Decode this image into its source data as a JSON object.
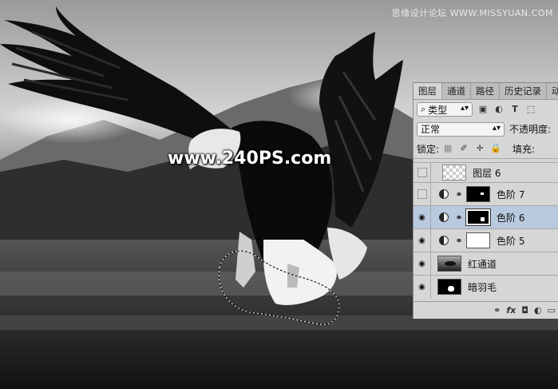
{
  "watermark_top": "思缘设计论坛 WWW.MISSYUAN.COM",
  "watermark_center": "www.240PS.com",
  "panel": {
    "tabs": [
      "图层",
      "通道",
      "路径",
      "历史记录",
      "动"
    ],
    "filter_label": "类型",
    "blend_mode": "正常",
    "opacity_label": "不透明度:",
    "lock_label": "锁定:",
    "fill_label": "填充:",
    "layers": [
      {
        "name": "图层 6",
        "visible": false,
        "type": "pixel"
      },
      {
        "name": "色阶 7",
        "visible": false,
        "type": "adjustment"
      },
      {
        "name": "色阶 6",
        "visible": true,
        "type": "adjustment",
        "selected": true
      },
      {
        "name": "色阶 5",
        "visible": true,
        "type": "adjustment"
      },
      {
        "name": "红通道",
        "visible": true,
        "type": "pixel"
      },
      {
        "name": "暗羽毛",
        "visible": true,
        "type": "pixel"
      }
    ],
    "footer_icons": [
      "link-icon",
      "fx-icon",
      "mask-icon",
      "adjustment-icon",
      "folder-icon"
    ],
    "footer_fx": "fx"
  }
}
